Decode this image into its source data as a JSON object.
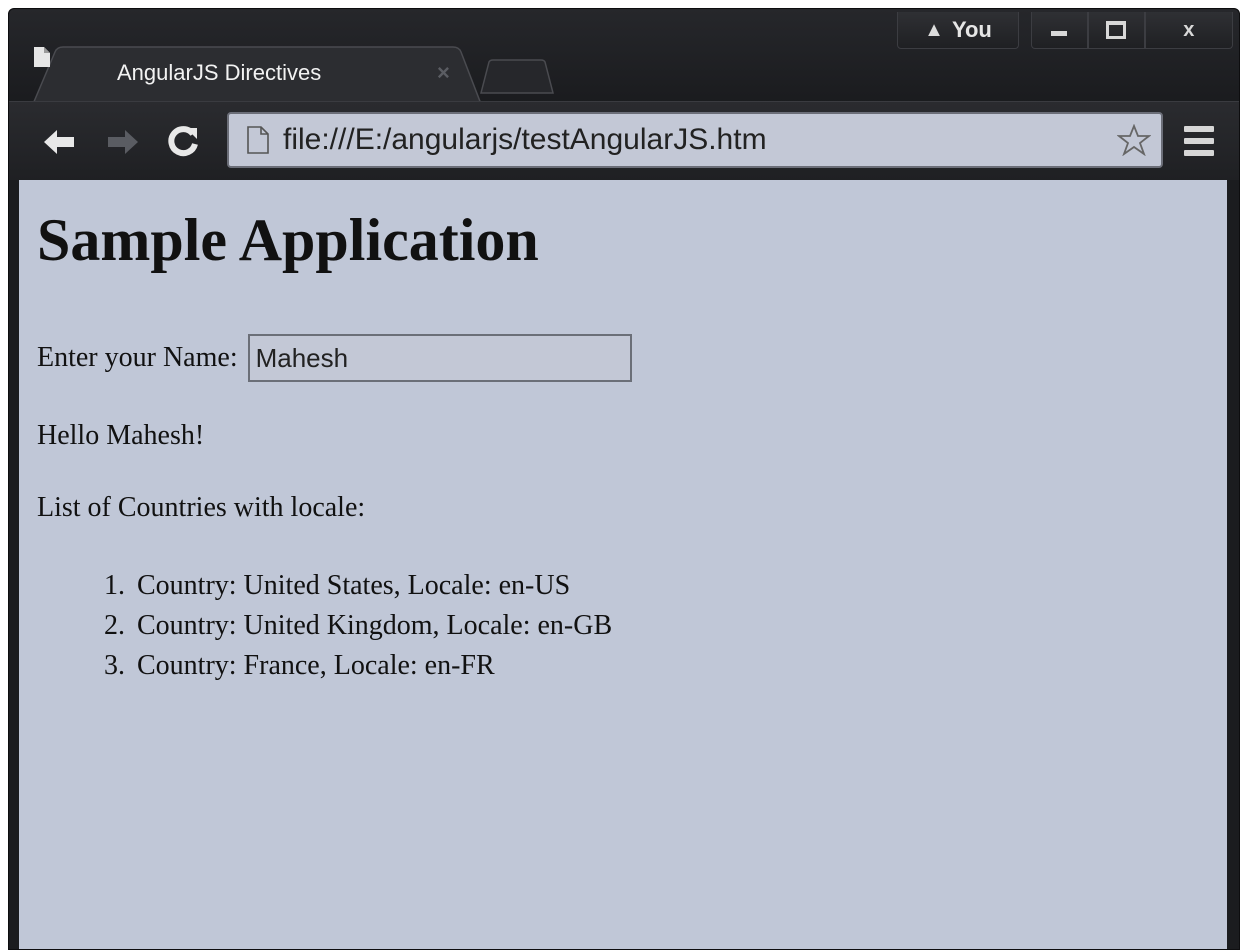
{
  "window": {
    "profile_label": "You",
    "controls": {
      "minimize": "minimize",
      "maximize": "maximize",
      "close": "x"
    }
  },
  "tab": {
    "title": "AngularJS Directives",
    "close": "×"
  },
  "toolbar": {
    "url": "file:///E:/angularjs/testAngularJS.htm"
  },
  "page": {
    "heading": "Sample Application",
    "name_label": "Enter your Name:",
    "name_value": "Mahesh",
    "greeting": "Hello Mahesh!",
    "list_title": "List of Countries with locale:",
    "countries": [
      {
        "num": "1.",
        "text": "Country: United States, Locale: en-US"
      },
      {
        "num": "2.",
        "text": "Country: United Kingdom, Locale: en-GB"
      },
      {
        "num": "3.",
        "text": "Country: France, Locale: en-FR"
      }
    ]
  },
  "colors": {
    "frame": "#1b1c1f",
    "page_background": "#c0c7d7",
    "omnibox_background": "#c3c8d6"
  },
  "icons": [
    "warning-icon",
    "page-icon",
    "back-arrow-icon",
    "forward-arrow-icon",
    "reload-icon",
    "star-icon",
    "menu-icon"
  ]
}
